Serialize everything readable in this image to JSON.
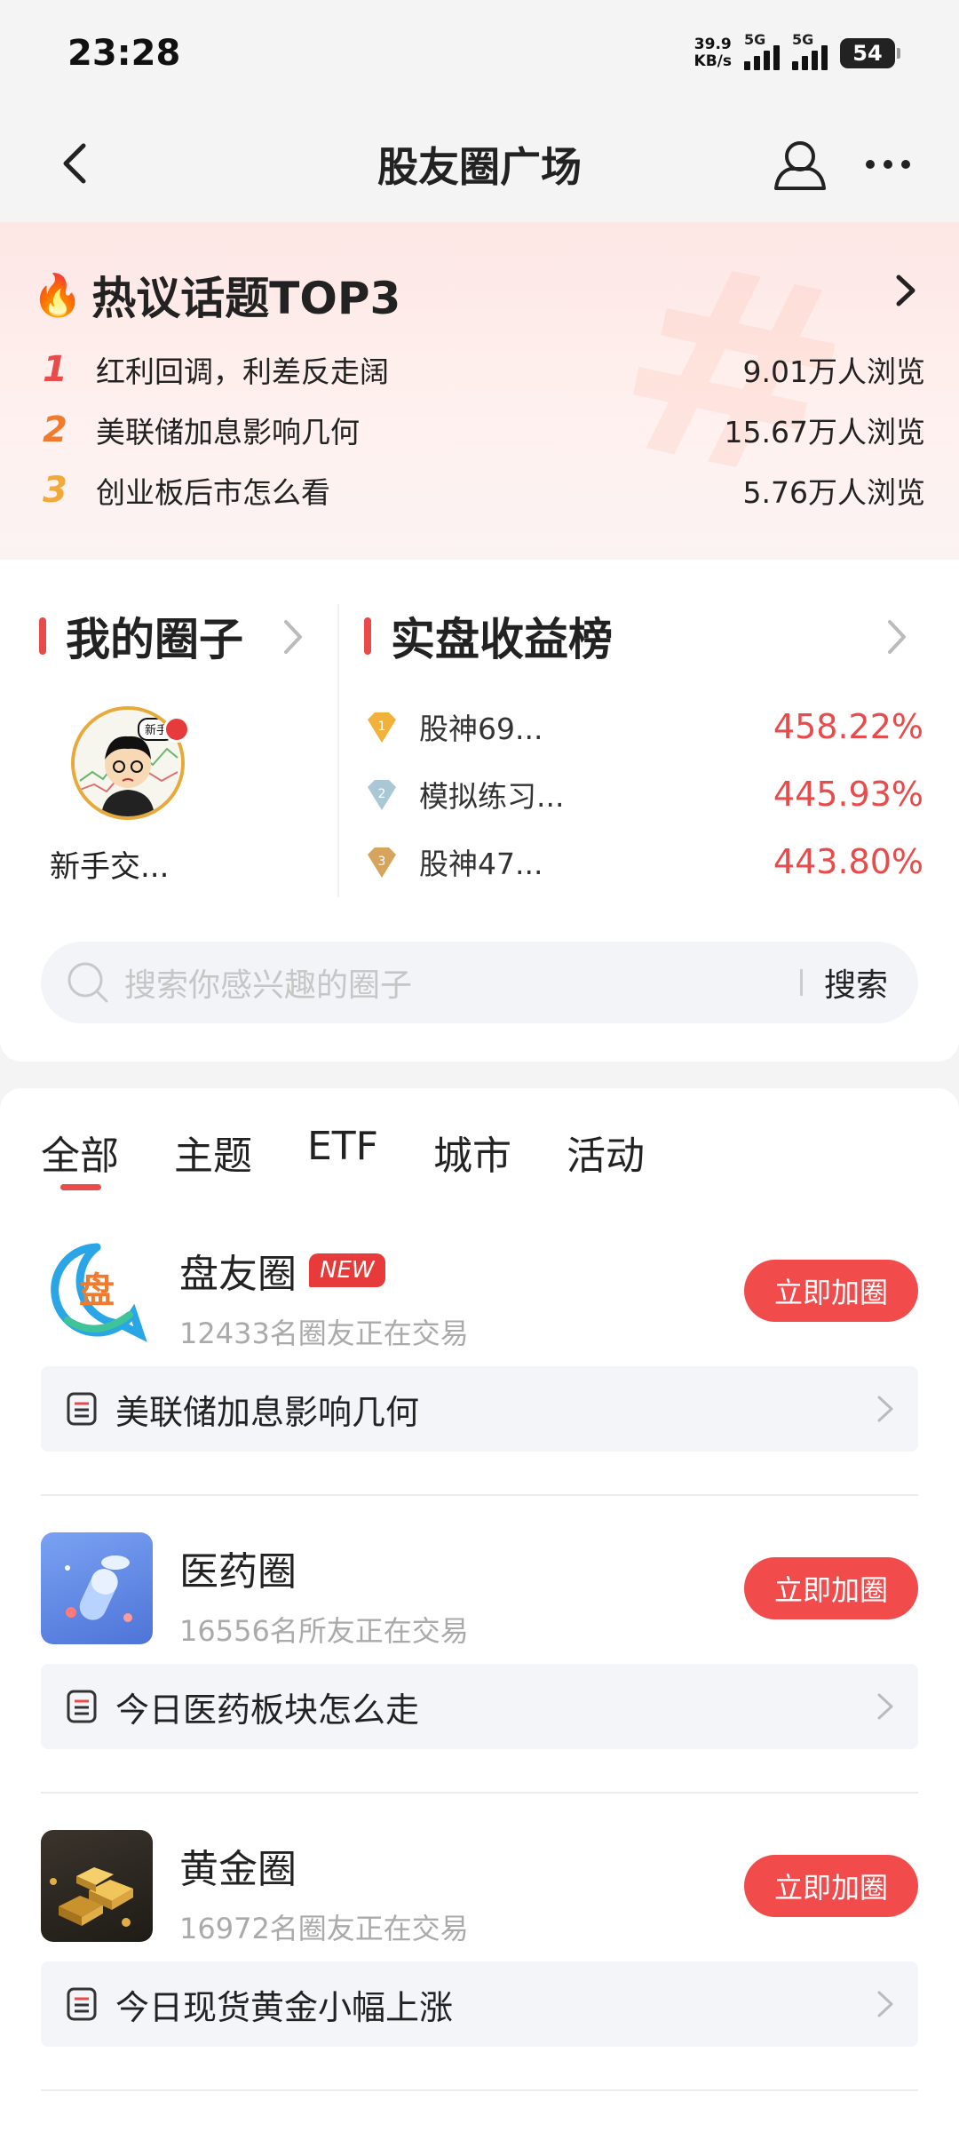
{
  "status": {
    "time": "23:28",
    "netspeed_top": "39.9",
    "netspeed_unit": "KB/s",
    "sim1": "5G",
    "sim2": "5G",
    "battery": "54"
  },
  "nav": {
    "title": "股友圈广场"
  },
  "hot": {
    "title": "热议话题TOP3",
    "fire_icon": "🔥",
    "items": [
      {
        "rank": "1",
        "topic": "红利回调，利差反走阔",
        "views": "9.01万人浏览",
        "color": "#e94b4b"
      },
      {
        "rank": "2",
        "topic": "美联储加息影响几何",
        "views": "15.67万人浏览",
        "color": "#f07a2d"
      },
      {
        "rank": "3",
        "topic": "创业板后市怎么看",
        "views": "5.76万人浏览",
        "color": "#f2a93b"
      }
    ]
  },
  "my_circle": {
    "title": "我的圈子",
    "item_name": "新手交...",
    "avatar_tag": "新手"
  },
  "ranking": {
    "title": "实盘收益榜",
    "items": [
      {
        "badge": "1",
        "name": "股神69...",
        "pct": "458.22%"
      },
      {
        "badge": "2",
        "name": "模拟练习...",
        "pct": "445.93%"
      },
      {
        "badge": "3",
        "name": "股神47...",
        "pct": "443.80%"
      }
    ]
  },
  "search": {
    "placeholder": "搜索你感兴趣的圈子",
    "button": "搜索"
  },
  "tabs": [
    "全部",
    "主题",
    "ETF",
    "城市",
    "活动"
  ],
  "groups": [
    {
      "name": "盘友圈",
      "badge": "NEW",
      "meta": "12433名圈友正在交易",
      "join": "立即加圈",
      "post": "美联储加息影响几何",
      "icon_char": "盘"
    },
    {
      "name": "医药圈",
      "meta": "16556名所友正在交易",
      "join": "立即加圈",
      "post": "今日医药板块怎么走"
    },
    {
      "name": "黄金圈",
      "meta": "16972名圈友正在交易",
      "join": "立即加圈",
      "post": "今日现货黄金小幅上涨"
    }
  ],
  "colors": {
    "accent": "#e94b4b",
    "join_button": "#f14b4b"
  }
}
